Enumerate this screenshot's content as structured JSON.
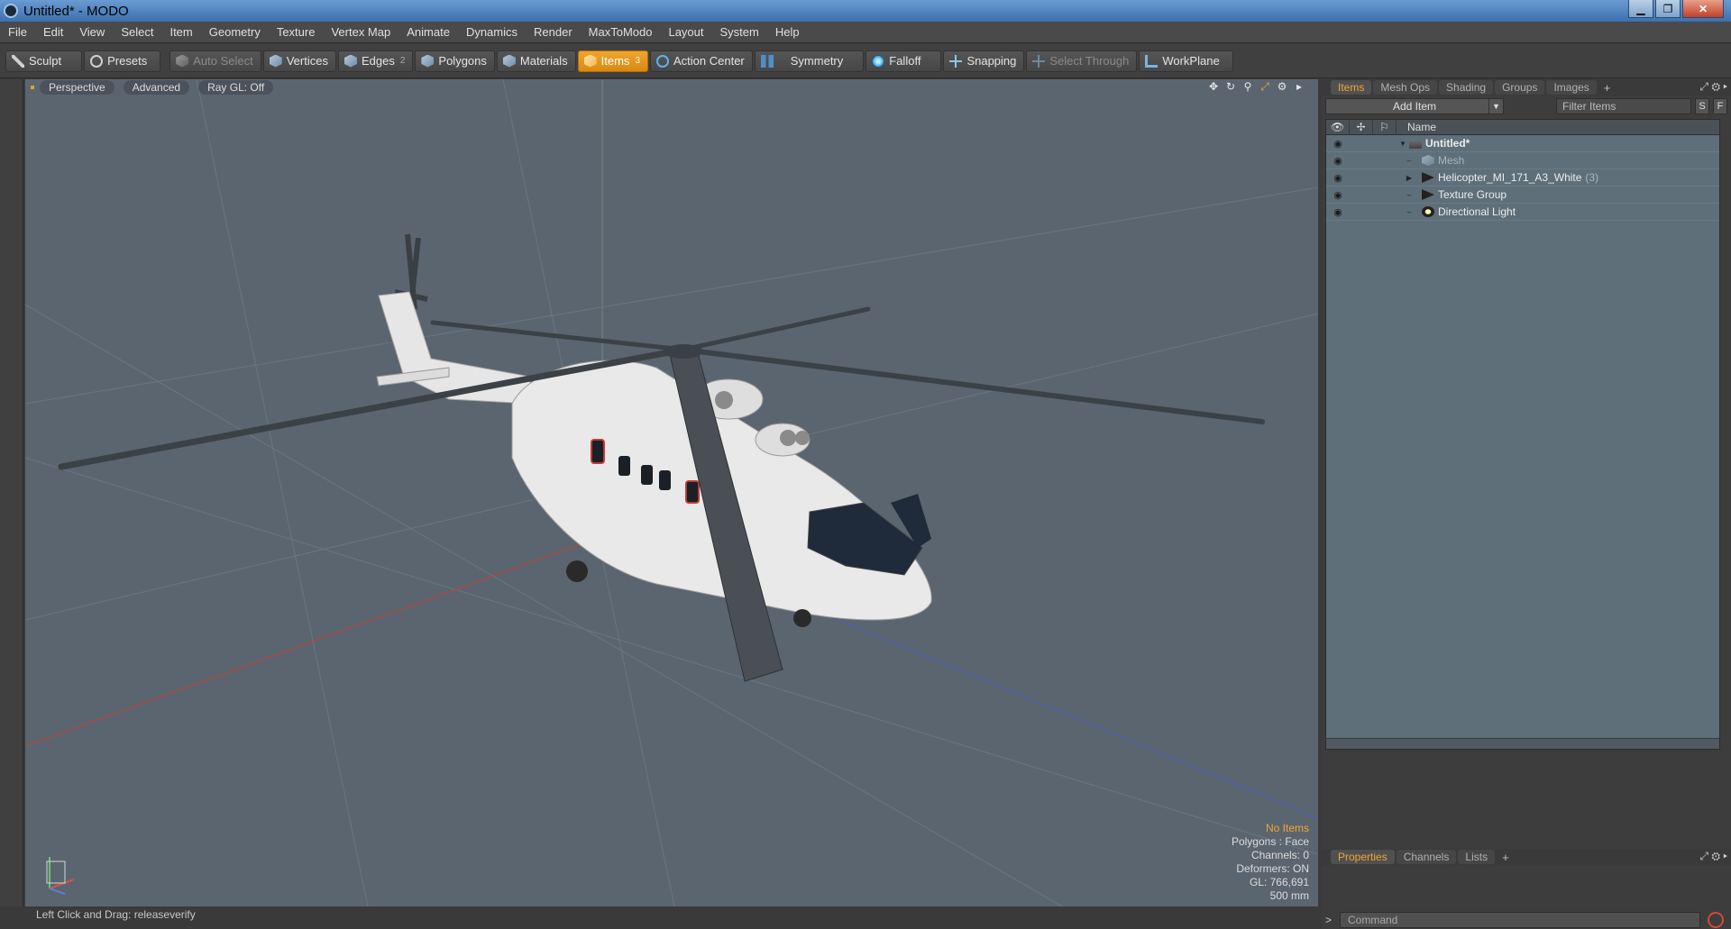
{
  "window": {
    "title": "Untitled* - MODO"
  },
  "menu": [
    "File",
    "Edit",
    "View",
    "Select",
    "Item",
    "Geometry",
    "Texture",
    "Vertex Map",
    "Animate",
    "Dynamics",
    "Render",
    "MaxToModo",
    "Layout",
    "System",
    "Help"
  ],
  "toolbar": {
    "sculpt": "Sculpt",
    "presets": "Presets",
    "auto_select": "Auto Select",
    "vertices": "Vertices",
    "edges": "Edges",
    "edges_count": "2",
    "polygons": "Polygons",
    "materials": "Materials",
    "items": "Items",
    "items_count": "3",
    "action_center": "Action Center",
    "symmetry": "Symmetry",
    "falloff": "Falloff",
    "snapping": "Snapping",
    "select_through": "Select Through",
    "workplane": "WorkPlane"
  },
  "viewport": {
    "tabs": [
      "Perspective",
      "Advanced",
      "Ray GL: Off"
    ],
    "stats": {
      "no_items": "No Items",
      "polygons": "Polygons : Face",
      "channels": "Channels: 0",
      "deformers": "Deformers: ON",
      "gl": "GL: 766,691",
      "size": "500 mm"
    }
  },
  "status": "Left Click and Drag:  releaseverify",
  "panel": {
    "tabs": [
      "Items",
      "Mesh Ops",
      "Shading",
      "Groups",
      "Images"
    ],
    "add_item": "Add Item",
    "filter_placeholder": "Filter Items",
    "btn_s": "S",
    "btn_f": "F",
    "column_name": "Name",
    "tree": [
      {
        "label": "Untitled*",
        "count": ""
      },
      {
        "label": "Mesh",
        "count": ""
      },
      {
        "label": "Helicopter_MI_171_A3_White",
        "count": "(3)"
      },
      {
        "label": "Texture Group",
        "count": ""
      },
      {
        "label": "Directional Light",
        "count": ""
      }
    ],
    "bottom_tabs": [
      "Properties",
      "Channels",
      "Lists"
    ],
    "command_placeholder": "Command",
    "command_prompt": ">"
  },
  "colors": {
    "accent": "#f1a630",
    "viewport_bg": "#5b6570",
    "tree_bg": "#5e6f79"
  }
}
